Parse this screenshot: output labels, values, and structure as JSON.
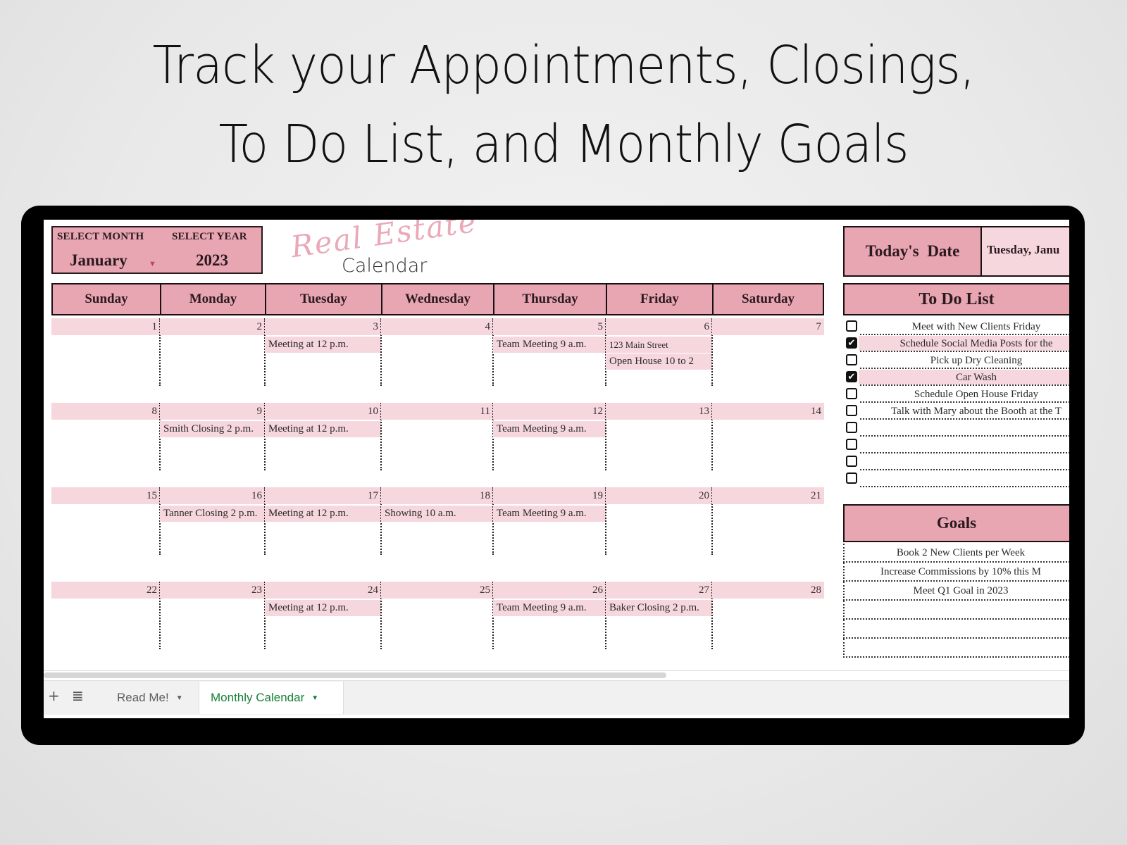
{
  "headline": {
    "line1": "Track your Appointments, Closings,",
    "line2": "To Do List, and Monthly Goals"
  },
  "selector": {
    "month_label": "SELECT MONTH",
    "year_label": "SELECT YEAR",
    "month_value": "January",
    "year_value": "2023",
    "dropdown_icon": "caret-down-icon"
  },
  "logo": {
    "script": "Real Estate",
    "word": "Calendar"
  },
  "calendar": {
    "days": [
      "Sunday",
      "Monday",
      "Tuesday",
      "Wednesday",
      "Thursday",
      "Friday",
      "Saturday"
    ],
    "weeks": [
      {
        "dates": [
          "1",
          "2",
          "3",
          "4",
          "5",
          "6",
          "7"
        ],
        "events": [
          [],
          [],
          [
            "Meeting at 12 p.m."
          ],
          [],
          [
            "Team Meeting 9 a.m."
          ],
          [
            "123 Main Street",
            "Open House 10 to 2"
          ],
          []
        ]
      },
      {
        "dates": [
          "8",
          "9",
          "10",
          "11",
          "12",
          "13",
          "14"
        ],
        "events": [
          [],
          [
            "Smith Closing 2 p.m."
          ],
          [
            "Meeting at 12 p.m."
          ],
          [],
          [
            "Team Meeting 9 a.m."
          ],
          [],
          []
        ]
      },
      {
        "dates": [
          "15",
          "16",
          "17",
          "18",
          "19",
          "20",
          "21"
        ],
        "events": [
          [],
          [
            "Tanner Closing 2 p.m."
          ],
          [
            "Meeting at 12 p.m."
          ],
          [
            "Showing 10 a.m."
          ],
          [
            "Team Meeting 9 a.m."
          ],
          [],
          []
        ]
      },
      {
        "dates": [
          "22",
          "23",
          "24",
          "25",
          "26",
          "27",
          "28"
        ],
        "events": [
          [],
          [],
          [
            "Meeting at 12 p.m."
          ],
          [],
          [
            "Team Meeting 9 a.m."
          ],
          [
            "Baker Closing 2 p.m."
          ],
          []
        ]
      }
    ]
  },
  "today": {
    "label": "Today's Date",
    "value": "Tuesday, Janu"
  },
  "todo": {
    "title": "To Do List",
    "items": [
      {
        "text": "Meet with New Clients Friday",
        "checked": false
      },
      {
        "text": "Schedule Social Media Posts for the",
        "checked": true
      },
      {
        "text": "Pick up Dry Cleaning",
        "checked": false
      },
      {
        "text": "Car Wash",
        "checked": true
      },
      {
        "text": "Schedule Open House Friday",
        "checked": false
      },
      {
        "text": "Talk with Mary about the Booth at the T",
        "checked": false
      },
      {
        "text": "",
        "checked": false
      },
      {
        "text": "",
        "checked": false
      },
      {
        "text": "",
        "checked": false
      },
      {
        "text": "",
        "checked": false
      }
    ]
  },
  "goals": {
    "title": "Goals",
    "items": [
      "Book 2 New Clients per Week",
      "Increase Commissions by 10% this M",
      "Meet Q1 Goal in 2023",
      "",
      "",
      ""
    ]
  },
  "tabs": {
    "add_icon": "+",
    "list_icon": "≣",
    "items": [
      {
        "label": "Read Me!",
        "active": false
      },
      {
        "label": "Monthly Calendar",
        "active": true
      }
    ],
    "caret": "▼"
  },
  "colors": {
    "header_pink": "#e8a5b2",
    "light_pink": "#f6d7dd",
    "active_tab_green": "#188038"
  }
}
